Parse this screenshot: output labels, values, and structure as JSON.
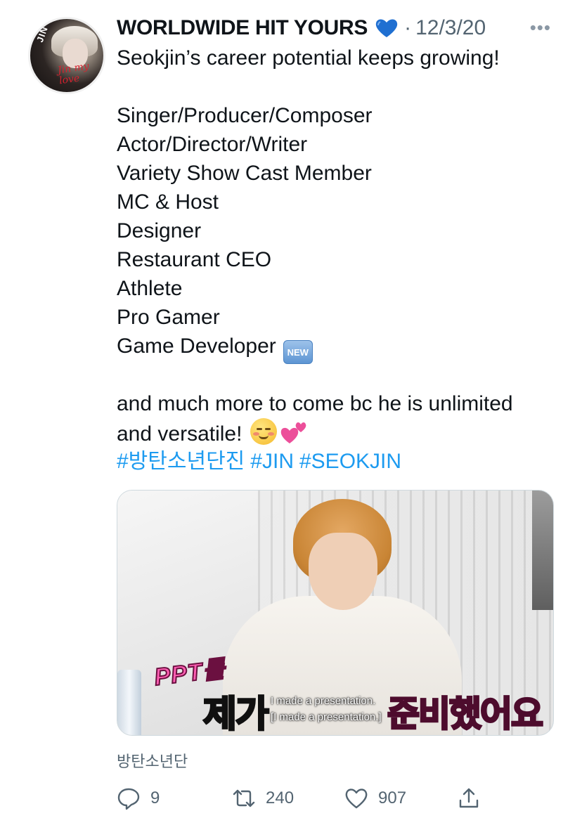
{
  "tweet": {
    "author_name": "WORLDWIDE HIT YOURS",
    "name_emoji_icon": "blue-heart-icon",
    "separator": "·",
    "date": "12/3/20",
    "more_icon": "more-options-icon",
    "avatar_text": "JIN CRAVE",
    "avatar_script": "Jin my love",
    "lines": [
      "Seokjin’s career potential keeps growing!",
      "",
      "Singer/Producer/Composer",
      "Actor/Director/Writer",
      "Variety Show Cast Member",
      "MC & Host",
      "Designer",
      "Restaurant CEO",
      "Athlete",
      "Pro Gamer",
      "Game Developer",
      "",
      "and much more to come bc he is unlimited",
      "and versatile!"
    ],
    "new_badge": "NEW",
    "hashtags": [
      "#방탄소년단진",
      "#JIN",
      "#SEOKJIN"
    ],
    "accent_color": "#1d9bf0"
  },
  "media": {
    "caption_pink_top": "PPT를",
    "caption_white": "제가",
    "caption_pink": "준비했어요",
    "subtitle_line1": "I made a presentation.",
    "subtitle_line2": "[I made a presentation.]"
  },
  "source": "방탄소년단",
  "actions": {
    "reply_count": "9",
    "retweet_count": "240",
    "like_count": "907",
    "share_icon": "share-icon"
  }
}
